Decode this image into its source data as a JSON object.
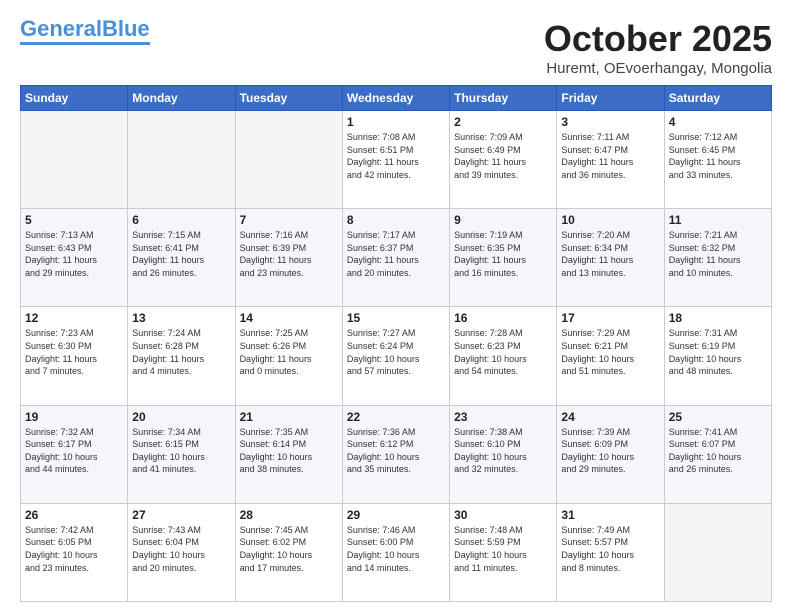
{
  "logo": {
    "part1": "General",
    "part2": "Blue"
  },
  "header": {
    "month": "October 2025",
    "location": "Huremt, OEvoerhangay, Mongolia"
  },
  "weekdays": [
    "Sunday",
    "Monday",
    "Tuesday",
    "Wednesday",
    "Thursday",
    "Friday",
    "Saturday"
  ],
  "weeks": [
    [
      {
        "day": "",
        "info": ""
      },
      {
        "day": "",
        "info": ""
      },
      {
        "day": "",
        "info": ""
      },
      {
        "day": "1",
        "info": "Sunrise: 7:08 AM\nSunset: 6:51 PM\nDaylight: 11 hours\nand 42 minutes."
      },
      {
        "day": "2",
        "info": "Sunrise: 7:09 AM\nSunset: 6:49 PM\nDaylight: 11 hours\nand 39 minutes."
      },
      {
        "day": "3",
        "info": "Sunrise: 7:11 AM\nSunset: 6:47 PM\nDaylight: 11 hours\nand 36 minutes."
      },
      {
        "day": "4",
        "info": "Sunrise: 7:12 AM\nSunset: 6:45 PM\nDaylight: 11 hours\nand 33 minutes."
      }
    ],
    [
      {
        "day": "5",
        "info": "Sunrise: 7:13 AM\nSunset: 6:43 PM\nDaylight: 11 hours\nand 29 minutes."
      },
      {
        "day": "6",
        "info": "Sunrise: 7:15 AM\nSunset: 6:41 PM\nDaylight: 11 hours\nand 26 minutes."
      },
      {
        "day": "7",
        "info": "Sunrise: 7:16 AM\nSunset: 6:39 PM\nDaylight: 11 hours\nand 23 minutes."
      },
      {
        "day": "8",
        "info": "Sunrise: 7:17 AM\nSunset: 6:37 PM\nDaylight: 11 hours\nand 20 minutes."
      },
      {
        "day": "9",
        "info": "Sunrise: 7:19 AM\nSunset: 6:35 PM\nDaylight: 11 hours\nand 16 minutes."
      },
      {
        "day": "10",
        "info": "Sunrise: 7:20 AM\nSunset: 6:34 PM\nDaylight: 11 hours\nand 13 minutes."
      },
      {
        "day": "11",
        "info": "Sunrise: 7:21 AM\nSunset: 6:32 PM\nDaylight: 11 hours\nand 10 minutes."
      }
    ],
    [
      {
        "day": "12",
        "info": "Sunrise: 7:23 AM\nSunset: 6:30 PM\nDaylight: 11 hours\nand 7 minutes."
      },
      {
        "day": "13",
        "info": "Sunrise: 7:24 AM\nSunset: 6:28 PM\nDaylight: 11 hours\nand 4 minutes."
      },
      {
        "day": "14",
        "info": "Sunrise: 7:25 AM\nSunset: 6:26 PM\nDaylight: 11 hours\nand 0 minutes."
      },
      {
        "day": "15",
        "info": "Sunrise: 7:27 AM\nSunset: 6:24 PM\nDaylight: 10 hours\nand 57 minutes."
      },
      {
        "day": "16",
        "info": "Sunrise: 7:28 AM\nSunset: 6:23 PM\nDaylight: 10 hours\nand 54 minutes."
      },
      {
        "day": "17",
        "info": "Sunrise: 7:29 AM\nSunset: 6:21 PM\nDaylight: 10 hours\nand 51 minutes."
      },
      {
        "day": "18",
        "info": "Sunrise: 7:31 AM\nSunset: 6:19 PM\nDaylight: 10 hours\nand 48 minutes."
      }
    ],
    [
      {
        "day": "19",
        "info": "Sunrise: 7:32 AM\nSunset: 6:17 PM\nDaylight: 10 hours\nand 44 minutes."
      },
      {
        "day": "20",
        "info": "Sunrise: 7:34 AM\nSunset: 6:15 PM\nDaylight: 10 hours\nand 41 minutes."
      },
      {
        "day": "21",
        "info": "Sunrise: 7:35 AM\nSunset: 6:14 PM\nDaylight: 10 hours\nand 38 minutes."
      },
      {
        "day": "22",
        "info": "Sunrise: 7:36 AM\nSunset: 6:12 PM\nDaylight: 10 hours\nand 35 minutes."
      },
      {
        "day": "23",
        "info": "Sunrise: 7:38 AM\nSunset: 6:10 PM\nDaylight: 10 hours\nand 32 minutes."
      },
      {
        "day": "24",
        "info": "Sunrise: 7:39 AM\nSunset: 6:09 PM\nDaylight: 10 hours\nand 29 minutes."
      },
      {
        "day": "25",
        "info": "Sunrise: 7:41 AM\nSunset: 6:07 PM\nDaylight: 10 hours\nand 26 minutes."
      }
    ],
    [
      {
        "day": "26",
        "info": "Sunrise: 7:42 AM\nSunset: 6:05 PM\nDaylight: 10 hours\nand 23 minutes."
      },
      {
        "day": "27",
        "info": "Sunrise: 7:43 AM\nSunset: 6:04 PM\nDaylight: 10 hours\nand 20 minutes."
      },
      {
        "day": "28",
        "info": "Sunrise: 7:45 AM\nSunset: 6:02 PM\nDaylight: 10 hours\nand 17 minutes."
      },
      {
        "day": "29",
        "info": "Sunrise: 7:46 AM\nSunset: 6:00 PM\nDaylight: 10 hours\nand 14 minutes."
      },
      {
        "day": "30",
        "info": "Sunrise: 7:48 AM\nSunset: 5:59 PM\nDaylight: 10 hours\nand 11 minutes."
      },
      {
        "day": "31",
        "info": "Sunrise: 7:49 AM\nSunset: 5:57 PM\nDaylight: 10 hours\nand 8 minutes."
      },
      {
        "day": "",
        "info": ""
      }
    ]
  ]
}
